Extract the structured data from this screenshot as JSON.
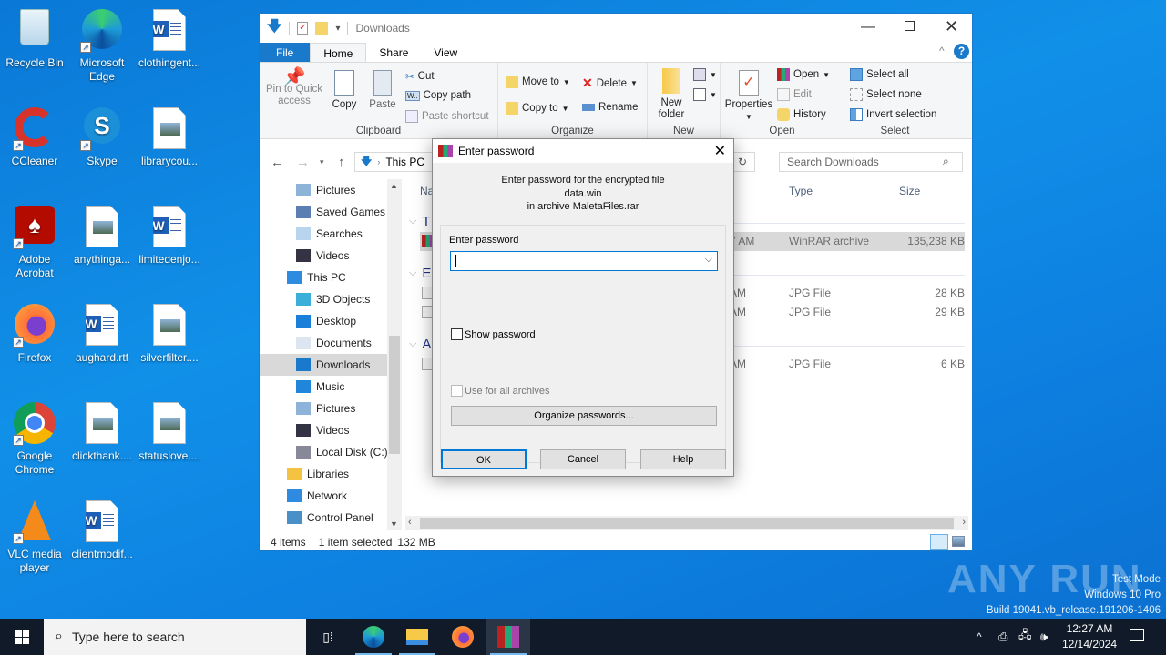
{
  "desktop": {
    "icons": [
      {
        "label": "Recycle Bin",
        "icon": "recycle-bin-icon"
      },
      {
        "label": "Microsoft Edge",
        "icon": "edge-icon"
      },
      {
        "label": "clothingent...",
        "icon": "word-doc-icon"
      },
      {
        "label": "CCleaner",
        "icon": "ccleaner-icon"
      },
      {
        "label": "Skype",
        "icon": "skype-icon"
      },
      {
        "label": "librarycou...",
        "icon": "image-file-icon"
      },
      {
        "label": "Adobe Acrobat",
        "icon": "acrobat-icon"
      },
      {
        "label": "anythinga...",
        "icon": "image-file-icon"
      },
      {
        "label": "limitedenjo...",
        "icon": "word-doc-icon"
      },
      {
        "label": "Firefox",
        "icon": "firefox-icon"
      },
      {
        "label": "aughard.rtf",
        "icon": "word-doc-icon"
      },
      {
        "label": "silverfilter....",
        "icon": "image-file-icon"
      },
      {
        "label": "Google Chrome",
        "icon": "chrome-icon"
      },
      {
        "label": "clickthank....",
        "icon": "image-file-icon"
      },
      {
        "label": "statuslove....",
        "icon": "image-file-icon"
      },
      {
        "label": "VLC media player",
        "icon": "vlc-icon"
      },
      {
        "label": "clientmodif...",
        "icon": "word-doc-icon"
      }
    ]
  },
  "explorer": {
    "title": "Downloads",
    "tabs": {
      "file": "File",
      "home": "Home",
      "share": "Share",
      "view": "View"
    },
    "ribbon": {
      "clipboard": {
        "label": "Clipboard",
        "pin": "Pin to Quick access",
        "copy": "Copy",
        "paste": "Paste",
        "cut": "Cut",
        "copy_path": "Copy path",
        "paste_shortcut": "Paste shortcut"
      },
      "organize": {
        "label": "Organize",
        "move_to": "Move to",
        "copy_to": "Copy to",
        "delete": "Delete",
        "rename": "Rename"
      },
      "new": {
        "label": "New",
        "new_folder": "New folder"
      },
      "open": {
        "label": "Open",
        "properties": "Properties",
        "open": "Open",
        "edit": "Edit",
        "history": "History"
      },
      "select": {
        "label": "Select",
        "select_all": "Select all",
        "select_none": "Select none",
        "invert": "Invert selection"
      }
    },
    "address": {
      "path": "This PC"
    },
    "search": {
      "placeholder": "Search Downloads"
    },
    "tree": [
      {
        "label": "Pictures",
        "level": 2
      },
      {
        "label": "Saved Games",
        "level": 2
      },
      {
        "label": "Searches",
        "level": 2
      },
      {
        "label": "Videos",
        "level": 2
      },
      {
        "label": "This PC",
        "level": 1
      },
      {
        "label": "3D Objects",
        "level": 2
      },
      {
        "label": "Desktop",
        "level": 2
      },
      {
        "label": "Documents",
        "level": 2
      },
      {
        "label": "Downloads",
        "level": 2,
        "selected": true
      },
      {
        "label": "Music",
        "level": 2
      },
      {
        "label": "Pictures",
        "level": 2
      },
      {
        "label": "Videos",
        "level": 2
      },
      {
        "label": "Local Disk (C:)",
        "level": 2
      },
      {
        "label": "Libraries",
        "level": 1
      },
      {
        "label": "Network",
        "level": 1
      },
      {
        "label": "Control Panel",
        "level": 1
      }
    ],
    "columns": {
      "name": "Na",
      "type": "Type",
      "size": "Size"
    },
    "groups": [
      {
        "label": "T",
        "rows": [
          {
            "date": "7 AM",
            "type": "WinRAR archive",
            "size": "135,238 KB",
            "selected": true
          }
        ]
      },
      {
        "label": "E",
        "rows": [
          {
            "date": "AM",
            "type": "JPG File",
            "size": "28 KB"
          },
          {
            "date": "AM",
            "type": "JPG File",
            "size": "29 KB"
          }
        ]
      },
      {
        "label": "A",
        "rows": [
          {
            "date": "AM",
            "type": "JPG File",
            "size": "6 KB"
          }
        ]
      }
    ],
    "status": {
      "items": "4 items",
      "selected": "1 item selected",
      "size": "132 MB"
    }
  },
  "dialog": {
    "title": "Enter password",
    "message_line1": "Enter password for the encrypted file",
    "message_line2": "data.win",
    "message_line3": "in archive MaletaFiles.rar",
    "field_label": "Enter password",
    "password_value": "",
    "show_password": "Show password",
    "use_for_all": "Use for all archives",
    "organize": "Organize passwords...",
    "ok": "OK",
    "cancel": "Cancel",
    "help": "Help"
  },
  "taskbar": {
    "search_placeholder": "Type here to search",
    "time": "12:27 AM",
    "date": "12/14/2024"
  },
  "watermark": {
    "brand": "ANY RUN",
    "line1": "Test Mode",
    "line2": "Windows 10 Pro",
    "line3": "Build 19041.vb_release.191206-1406"
  }
}
